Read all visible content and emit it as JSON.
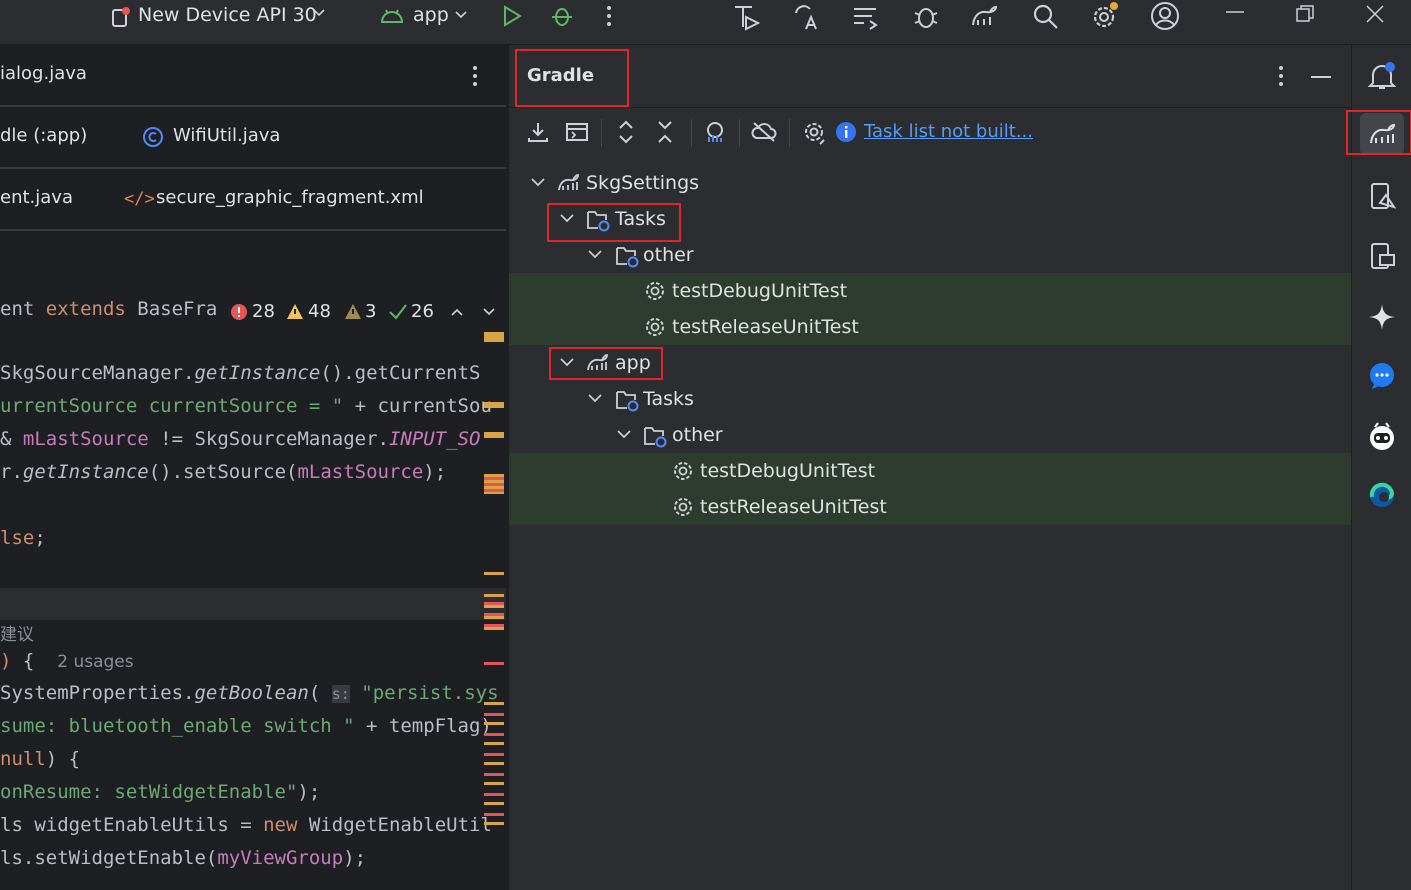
{
  "toolbar": {
    "device": "New Device API 30",
    "run_config": "app",
    "icons": [
      "device-icon",
      "android-icon",
      "run-icon",
      "debug-icon",
      "more-icon",
      "profile-icon",
      "translate-icon",
      "list-icon",
      "bug-icon",
      "gradle-icon",
      "search-icon",
      "settings-icon",
      "account-icon",
      "minimize-icon",
      "restore-icon",
      "close-icon"
    ]
  },
  "editor": {
    "tab_rows": [
      [
        "ialog.java"
      ],
      [
        "dle (:app)",
        "WifiUtil.java"
      ],
      [
        "ent.java",
        "secure_graphic_fragment.xml"
      ]
    ],
    "inspections": {
      "errors": "28",
      "warnings": "48",
      "weak_warnings": "3",
      "ok": "26"
    },
    "first_line": {
      "a": "ent ",
      "b": "extends",
      "c": " BaseFra"
    },
    "lines": [
      "SkgSourceManager.getInstance().getCurrentS",
      "urrentSource currentSource = \" + currentSou",
      "& mLastSource != SkgSourceManager.INPUT_SO",
      "r.getInstance().setSource(mLastSource);",
      "",
      "lse;"
    ],
    "hint": "建议",
    "usages": "2 usages",
    "lines2": [
      "SystemProperties.getBoolean( s: \"persist.sys",
      "sume: bluetooth_enable switch \" + tempFlag)",
      "null) {",
      "onResume: setWidgetEnable\");",
      "ls widgetEnableUtils = new WidgetEnableUtil",
      "ls.setWidgetEnable(myViewGroup);"
    ]
  },
  "gradle": {
    "title": "Gradle",
    "info_link": "Task list not built...",
    "tree": [
      {
        "label": "SkgSettings",
        "icon": "gradle-icon",
        "depth": 0,
        "expanded": true
      },
      {
        "label": "Tasks",
        "icon": "folder-gear-icon",
        "depth": 1,
        "expanded": true
      },
      {
        "label": "other",
        "icon": "folder-gear-icon",
        "depth": 2,
        "expanded": true
      },
      {
        "label": "testDebugUnitTest",
        "icon": "gear-icon",
        "depth": 3
      },
      {
        "label": "testReleaseUnitTest",
        "icon": "gear-icon",
        "depth": 3
      },
      {
        "label": "app",
        "icon": "gradle-icon",
        "depth": 1,
        "expanded": true
      },
      {
        "label": "Tasks",
        "icon": "folder-gear-icon",
        "depth": 2,
        "expanded": true
      },
      {
        "label": "other",
        "icon": "folder-gear-icon",
        "depth": 3,
        "expanded": true
      },
      {
        "label": "testDebugUnitTest",
        "icon": "gear-icon",
        "depth": 4
      },
      {
        "label": "testReleaseUnitTest",
        "icon": "gear-icon",
        "depth": 4
      }
    ]
  },
  "colors": {
    "highlight": "#e0252b",
    "selection": "#2e3b2f",
    "link": "#589df6"
  }
}
